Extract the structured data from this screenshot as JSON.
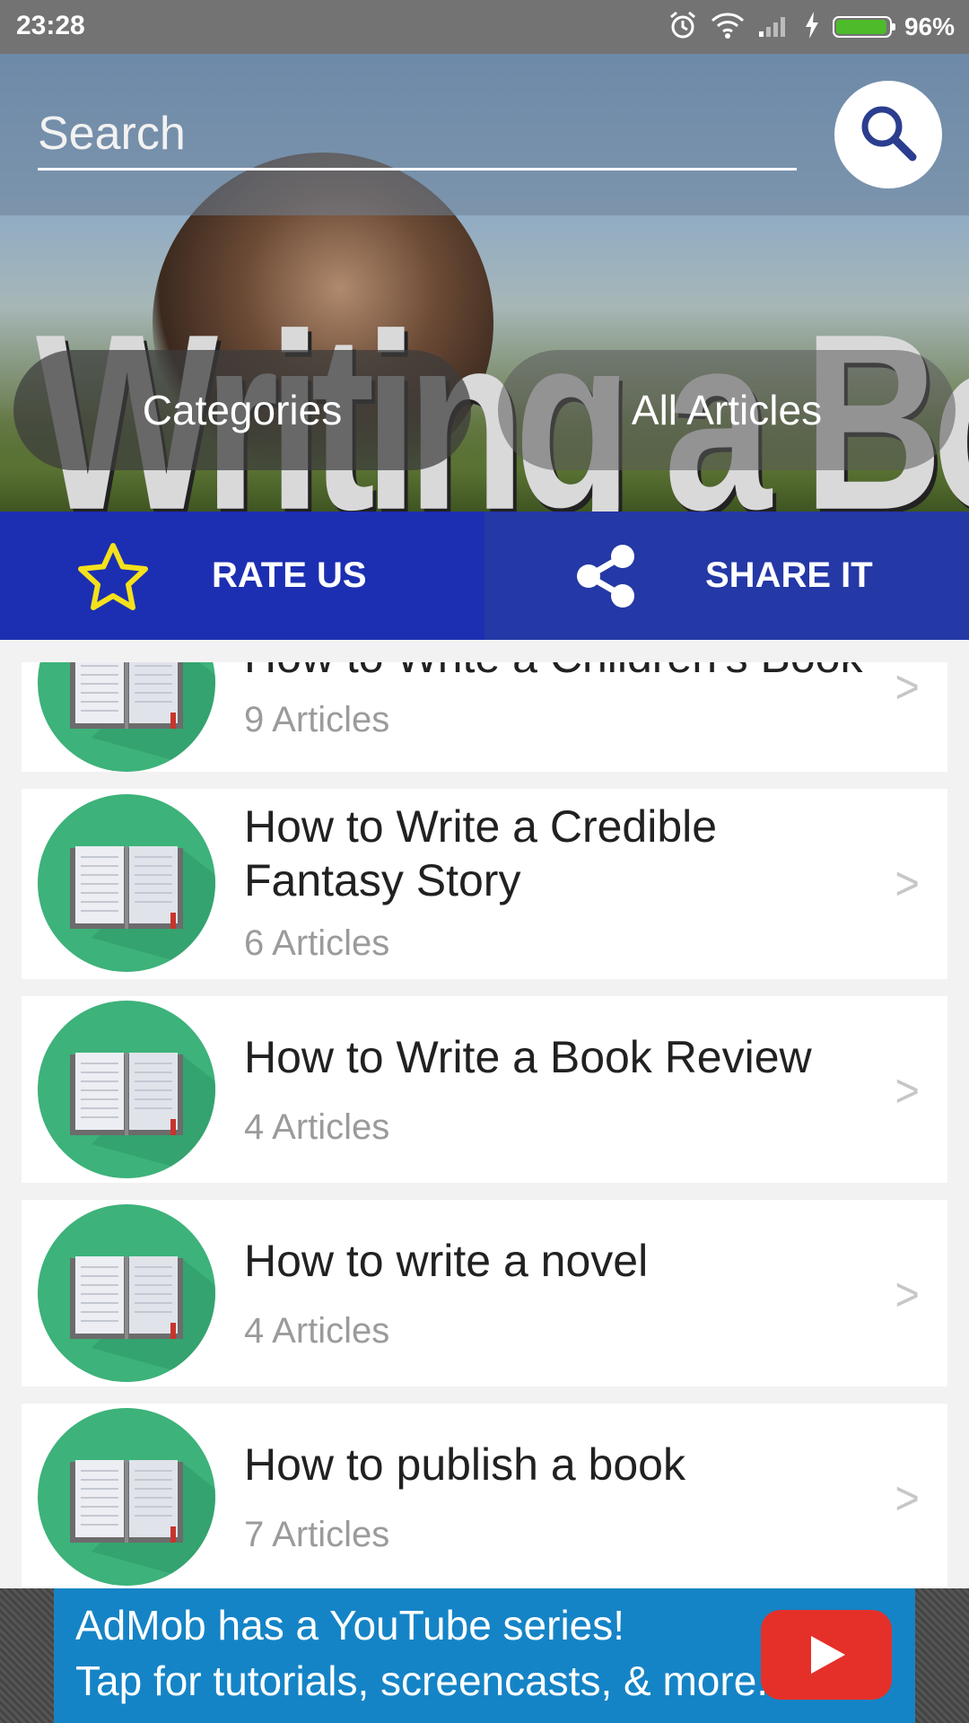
{
  "status_bar": {
    "time": "23:28",
    "battery_percent": "96%",
    "battery_level": 0.96,
    "icons": [
      "alarm-icon",
      "wifi-icon",
      "signal-icon",
      "charging-icon",
      "battery-icon"
    ]
  },
  "header": {
    "search": {
      "placeholder": "Search",
      "value": ""
    },
    "banner_title": "Writing a Book",
    "categories_label": "Categories",
    "all_articles_label": "All Articles"
  },
  "actions": {
    "rate_label": "RATE US",
    "share_label": "SHARE IT"
  },
  "list": {
    "chevron": ">",
    "items": [
      {
        "title": "How to Write a Children's Book",
        "count": "9 Articles"
      },
      {
        "title": "How to Write a Credible Fantasy Story",
        "count": "6 Articles"
      },
      {
        "title": "How to Write a Book Review",
        "count": "4 Articles"
      },
      {
        "title": "How to write a novel",
        "count": "4 Articles"
      },
      {
        "title": "How to publish a book",
        "count": "7 Articles"
      }
    ]
  },
  "ad": {
    "line1": "AdMob has a YouTube series!",
    "line2": "Tap for tutorials, screencasts, & more."
  },
  "colors": {
    "action_bar": "#1c2fb2",
    "avatar": "#3db27a",
    "ad_background": "#1584c6",
    "youtube_red": "#e5302a"
  }
}
